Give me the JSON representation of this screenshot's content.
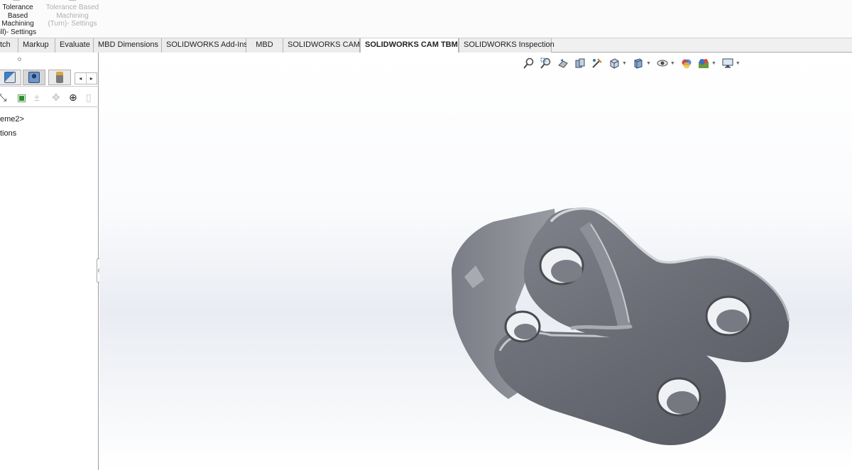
{
  "ribbon": {
    "buttons": [
      {
        "lines": [
          "Tolerance",
          "Based",
          "Machining",
          "ill)- Settings"
        ],
        "enabled": true
      },
      {
        "lines": [
          "Tolerance Based",
          "Machining",
          "(Turn)- Settings"
        ],
        "enabled": false
      }
    ]
  },
  "tabs": [
    {
      "label": "tch",
      "active": false
    },
    {
      "label": "Markup",
      "active": false
    },
    {
      "label": "Evaluate",
      "active": false
    },
    {
      "label": "MBD Dimensions",
      "active": false
    },
    {
      "label": "SOLIDWORKS Add-Ins",
      "active": false
    },
    {
      "label": "MBD",
      "active": false
    },
    {
      "label": "SOLIDWORKS CAM",
      "active": false
    },
    {
      "label": "SOLIDWORKS CAM TBM",
      "active": true
    },
    {
      "label": "SOLIDWORKS Inspection",
      "active": false
    }
  ],
  "left_panel": {
    "tabs": [
      {
        "icon": "property-manager-icon",
        "selected": false
      },
      {
        "icon": "configuration-manager-icon",
        "selected": true
      },
      {
        "icon": "cam-feature-tree-icon",
        "selected": false
      }
    ],
    "scroll_arrows": [
      "◂",
      "▸"
    ],
    "tools": [
      {
        "icon": "wrench-icon",
        "enabled": true
      },
      {
        "icon": "generate-operation-plan-icon",
        "enabled": true
      },
      {
        "icon": "add-toolpath-icon",
        "enabled": false
      },
      {
        "icon": "setup-origin-icon",
        "enabled": false
      },
      {
        "icon": "machine-setup-icon",
        "enabled": true
      },
      {
        "icon": "tool-crib-icon",
        "enabled": false
      }
    ],
    "tree_items": [
      "eme2>",
      "tions"
    ]
  },
  "heads_up_toolbar": {
    "tools": [
      {
        "icon": "zoom-to-fit-icon",
        "dropdown": false
      },
      {
        "icon": "zoom-to-area-icon",
        "dropdown": false
      },
      {
        "icon": "previous-view-icon",
        "dropdown": false
      },
      {
        "icon": "section-view-icon",
        "dropdown": false
      },
      {
        "icon": "dynamic-annotation-views-icon",
        "dropdown": false
      },
      {
        "icon": "view-orientation-icon",
        "dropdown": true
      },
      {
        "icon": "display-style-icon",
        "dropdown": true
      },
      {
        "icon": "hide-show-items-icon",
        "dropdown": true
      },
      {
        "icon": "edit-appearance-icon",
        "dropdown": false
      },
      {
        "icon": "apply-scene-icon",
        "dropdown": true
      },
      {
        "icon": "view-settings-icon",
        "dropdown": true
      }
    ]
  },
  "colors": {
    "model": "#6e7079",
    "model_highlight": "#c7c8ce",
    "model_shadow": "#4a4b52",
    "active_tab_bg": "#ffffff"
  }
}
